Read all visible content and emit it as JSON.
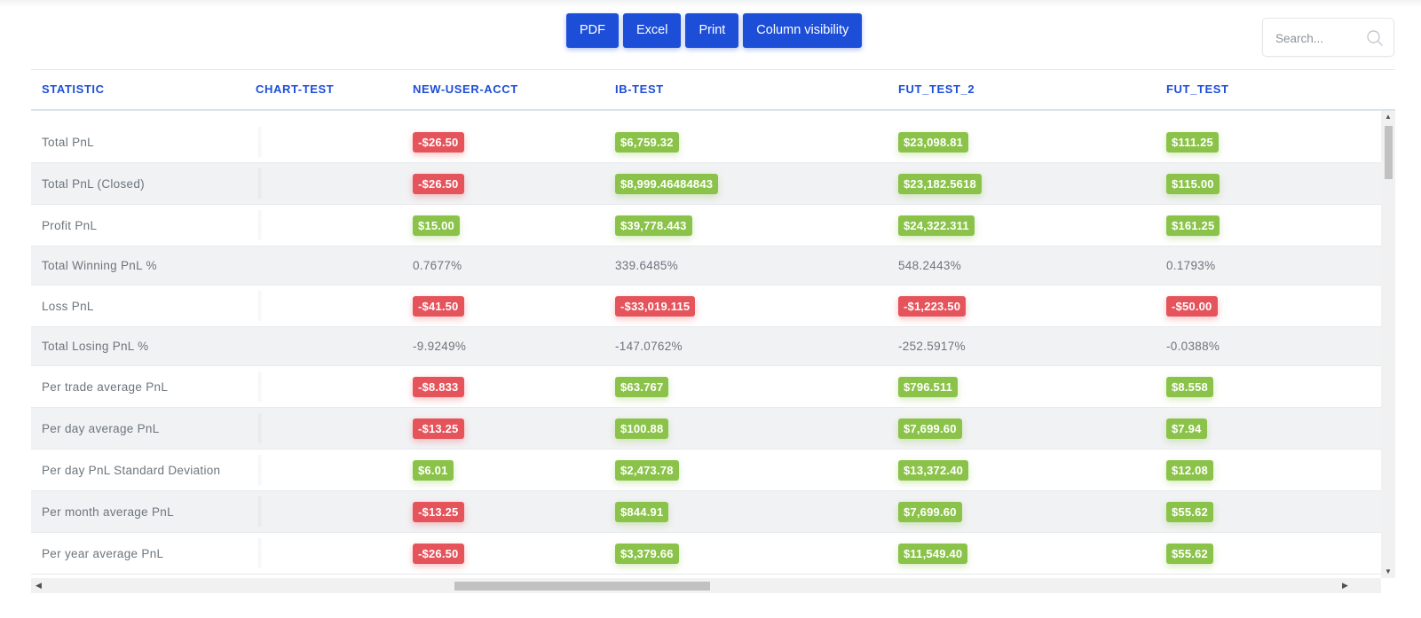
{
  "toolbar": {
    "buttons": [
      "PDF",
      "Excel",
      "Print",
      "Column visibility"
    ]
  },
  "search": {
    "placeholder": "Search..."
  },
  "table": {
    "columns": [
      "STATISTIC",
      "CHART-TEST",
      "NEW-USER-ACCT",
      "IB-TEST",
      "FUT_TEST_2",
      "FUT_TEST"
    ],
    "rows": [
      {
        "label": "Total PnL",
        "cells": [
          {
            "text": "-$26.50",
            "type": "neg"
          },
          {
            "text": "$6,759.32",
            "type": "pos"
          },
          {
            "text": "$23,098.81",
            "type": "pos"
          },
          {
            "text": "$111.25",
            "type": "pos"
          }
        ]
      },
      {
        "label": "Total PnL (Closed)",
        "cells": [
          {
            "text": "-$26.50",
            "type": "neg"
          },
          {
            "text": "$8,999.46484843",
            "type": "pos"
          },
          {
            "text": "$23,182.5618",
            "type": "pos"
          },
          {
            "text": "$115.00",
            "type": "pos"
          }
        ]
      },
      {
        "label": "Profit PnL",
        "cells": [
          {
            "text": "$15.00",
            "type": "pos"
          },
          {
            "text": "$39,778.443",
            "type": "pos"
          },
          {
            "text": "$24,322.311",
            "type": "pos"
          },
          {
            "text": "$161.25",
            "type": "pos"
          }
        ]
      },
      {
        "label": "Total Winning PnL %",
        "cells": [
          {
            "text": "0.7677%",
            "type": "plain"
          },
          {
            "text": "339.6485%",
            "type": "plain"
          },
          {
            "text": "548.2443%",
            "type": "plain"
          },
          {
            "text": "0.1793%",
            "type": "plain"
          }
        ]
      },
      {
        "label": "Loss PnL",
        "cells": [
          {
            "text": "-$41.50",
            "type": "neg"
          },
          {
            "text": "-$33,019.115",
            "type": "neg"
          },
          {
            "text": "-$1,223.50",
            "type": "neg"
          },
          {
            "text": "-$50.00",
            "type": "neg"
          }
        ]
      },
      {
        "label": "Total Losing PnL %",
        "cells": [
          {
            "text": "-9.9249%",
            "type": "plain"
          },
          {
            "text": "-147.0762%",
            "type": "plain"
          },
          {
            "text": "-252.5917%",
            "type": "plain"
          },
          {
            "text": "-0.0388%",
            "type": "plain"
          }
        ]
      },
      {
        "label": "Per trade average PnL",
        "cells": [
          {
            "text": "-$8.833",
            "type": "neg"
          },
          {
            "text": "$63.767",
            "type": "pos"
          },
          {
            "text": "$796.511",
            "type": "pos"
          },
          {
            "text": "$8.558",
            "type": "pos"
          }
        ]
      },
      {
        "label": "Per day average PnL",
        "cells": [
          {
            "text": "-$13.25",
            "type": "neg"
          },
          {
            "text": "$100.88",
            "type": "pos"
          },
          {
            "text": "$7,699.60",
            "type": "pos"
          },
          {
            "text": "$7.94",
            "type": "pos"
          }
        ]
      },
      {
        "label": "Per day PnL Standard Deviation",
        "cells": [
          {
            "text": "$6.01",
            "type": "pos"
          },
          {
            "text": "$2,473.78",
            "type": "pos"
          },
          {
            "text": "$13,372.40",
            "type": "pos"
          },
          {
            "text": "$12.08",
            "type": "pos"
          }
        ]
      },
      {
        "label": "Per month average PnL",
        "cells": [
          {
            "text": "-$13.25",
            "type": "neg"
          },
          {
            "text": "$844.91",
            "type": "pos"
          },
          {
            "text": "$7,699.60",
            "type": "pos"
          },
          {
            "text": "$55.62",
            "type": "pos"
          }
        ]
      },
      {
        "label": "Per year average PnL",
        "cells": [
          {
            "text": "-$26.50",
            "type": "neg"
          },
          {
            "text": "$3,379.66",
            "type": "pos"
          },
          {
            "text": "$11,549.40",
            "type": "pos"
          },
          {
            "text": "$55.62",
            "type": "pos"
          }
        ]
      }
    ]
  },
  "colors": {
    "accent": "#1d4ed8",
    "positive_badge": "#8bc34a",
    "negative_badge": "#e5535b",
    "stripe": "#f1f2f4"
  },
  "icons": {
    "search": "magnifier-icon",
    "scroll_up": "up-triangle",
    "scroll_down": "down-triangle",
    "scroll_left": "left-triangle",
    "scroll_right": "right-triangle"
  }
}
